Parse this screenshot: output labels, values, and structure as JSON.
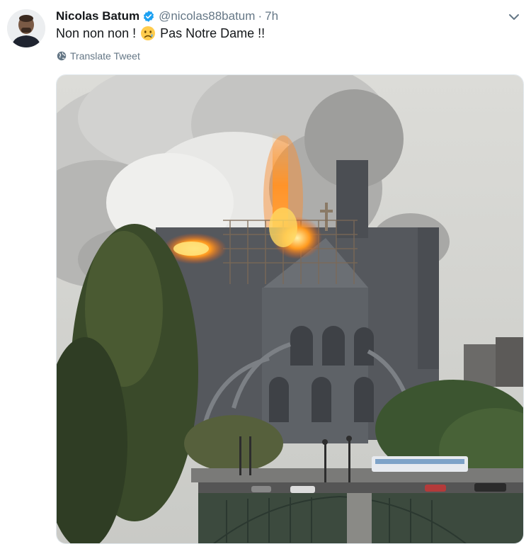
{
  "tweet": {
    "author_name": "Nicolas Batum",
    "handle": "@nicolas88batum",
    "separator": "·",
    "timestamp": "7h",
    "text_before_emoji": "Non non non !",
    "text_after_emoji": "Pas Notre Dame !!",
    "translate_label": "Translate Tweet"
  },
  "icons": {
    "verified": "verified-badge-icon",
    "menu": "chevron-down-icon",
    "translate": "globe-icon",
    "emoji": "sad-face-emoji"
  },
  "colors": {
    "verified_blue": "#1da1f2",
    "secondary_text": "#657786",
    "primary_text": "#14171a"
  }
}
